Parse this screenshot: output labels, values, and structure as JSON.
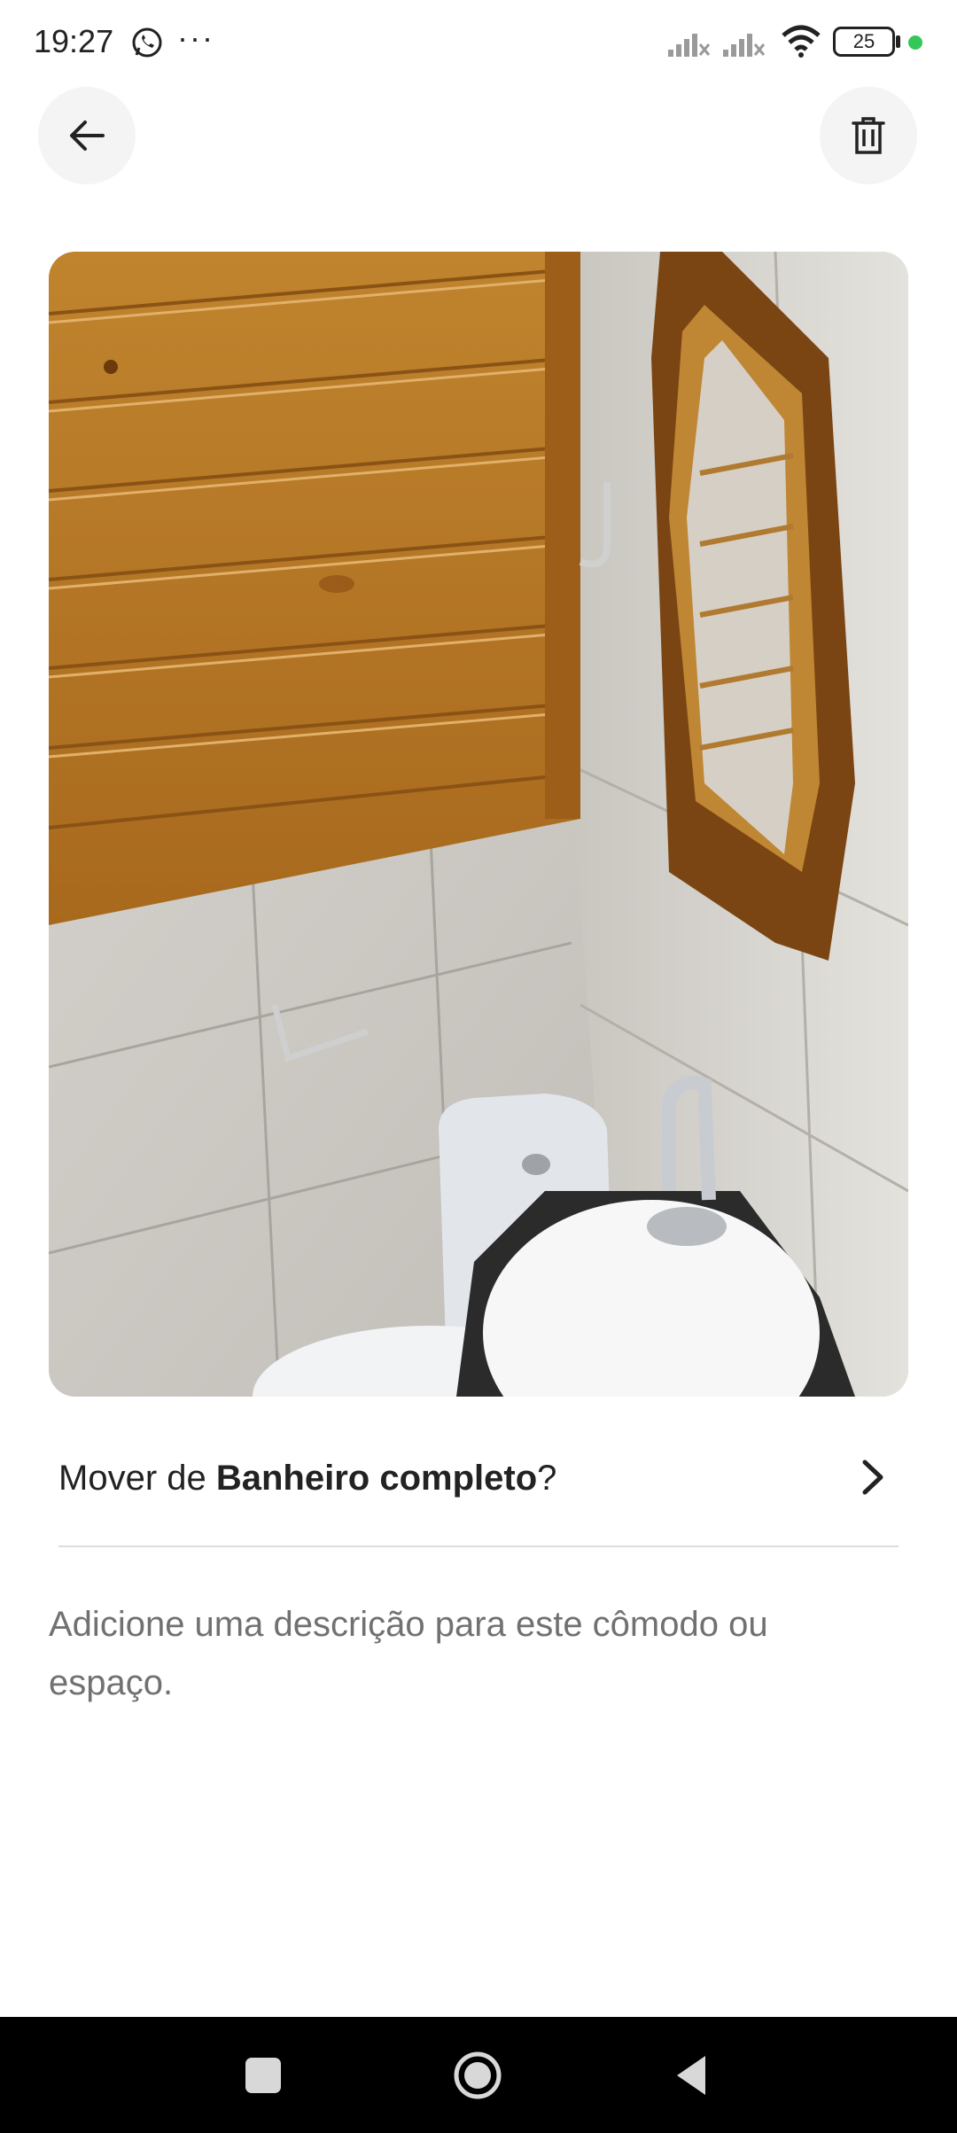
{
  "status_bar": {
    "time": "19:27",
    "more": "···",
    "battery": "25",
    "dot_color": "#34c759"
  },
  "header": {
    "back_icon": "arrow-left-icon",
    "delete_icon": "trash-icon"
  },
  "photo": {
    "description_icon": "bathroom-photo"
  },
  "move": {
    "prefix": "Mover de ",
    "room": "Banheiro completo",
    "suffix": "?",
    "icon": "chevron-right-icon"
  },
  "description": {
    "placeholder": "Adicione uma descrição para este cômodo ou espaço."
  },
  "nav_bar": {
    "recents_icon": "square-icon",
    "home_icon": "circle-home-icon",
    "back_icon": "triangle-back-icon"
  }
}
